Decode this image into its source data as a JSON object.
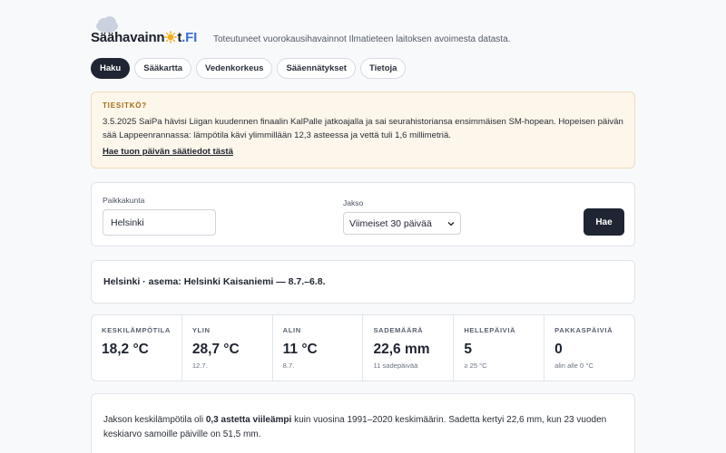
{
  "header": {
    "logo": {
      "text_main": "Säähavainn",
      "text_after_sun": "t",
      "text_fi": ".FI"
    },
    "tagline": "Toteutuneet vuorokausihavainnot Ilmatieteen laitoksen avoimesta datasta."
  },
  "tabs": [
    {
      "label": "Haku",
      "active": true
    },
    {
      "label": "Sääkartta",
      "active": false
    },
    {
      "label": "Vedenkorkeus",
      "active": false
    },
    {
      "label": "Sääennätykset",
      "active": false
    },
    {
      "label": "Tietoja",
      "active": false
    }
  ],
  "notice": {
    "title": "TIESITKÖ?",
    "text": "3.5.2025 SaiPa hävisi Liigan kuudennen finaalin KalPalle jatkoajalla ja sai seurahistoriansa ensimmäisen SM-hopean. Hopeisen päivän sää Lappeenrannassa: lämpötila kävi ylimmillään 12,3 asteessa ja vettä tuli 1,6 millimetriä.",
    "link": "Hae tuon päivän säätiedot tästä"
  },
  "form": {
    "city_label": "Paikkakunta",
    "city_value": "Helsinki",
    "period_label": "Jakso",
    "period_value": "Viimeiset 30 päivää",
    "submit_label": "Hae"
  },
  "station": {
    "title": "Helsinki · asema: Helsinki Kaisaniemi — 8.7.–6.8."
  },
  "stats": [
    {
      "label": "KESKILÄMPÖTILA",
      "value": "18,2 °C",
      "sub": ""
    },
    {
      "label": "YLIN",
      "value": "28,7 °C",
      "sub": "12.7."
    },
    {
      "label": "ALIN",
      "value": "11 °C",
      "sub": "8.7."
    },
    {
      "label": "SADEMÄÄRÄ",
      "value": "22,6 mm",
      "sub": "11 sadepäivää"
    },
    {
      "label": "HELLEPÄIVIÄ",
      "value": "5",
      "sub": "≥ 25 °C"
    },
    {
      "label": "PAKKASPÄIVIÄ",
      "value": "0",
      "sub": "alin alle 0 °C"
    }
  ],
  "summary": {
    "pre": "Jakson keskilämpötila oli ",
    "bold": "0,3 astetta viileämpi",
    "post": " kuin vuosina 1991–2020 keskimäärin. Sadetta kertyi 22,6 mm, kun 23 vuoden keskiarvo samoille päiville on 51,5 mm."
  },
  "colors": {
    "accent_dark": "#1f2532",
    "logo_fi": "#3b6fd6",
    "sun": "#f2b01e",
    "notice_bg": "#fdf6ea",
    "notice_title": "#a46c14"
  }
}
